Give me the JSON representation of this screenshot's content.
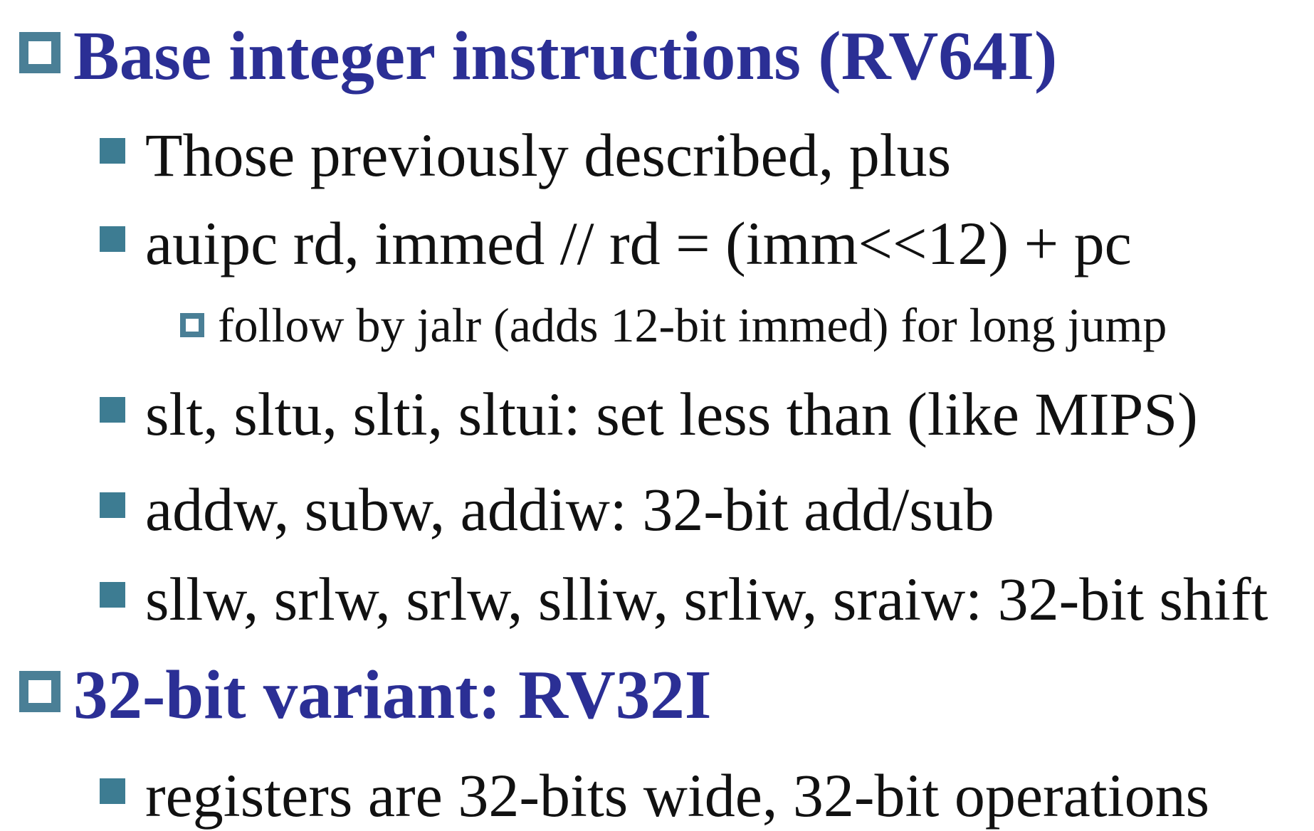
{
  "items": [
    {
      "level": 1,
      "text": "Base integer instructions (RV64I)",
      "bullet_icon": "hollow-square-icon"
    },
    {
      "level": 2,
      "text": "Those previously described, plus",
      "bullet_icon": "solid-square-icon"
    },
    {
      "level": 2,
      "text": "auipc rd, immed  // rd = (imm<<12) + pc",
      "bullet_icon": "solid-square-icon"
    },
    {
      "level": 3,
      "text": "follow by jalr (adds 12-bit immed) for long jump",
      "bullet_icon": "hollow-square-icon"
    },
    {
      "level": 2,
      "text": "slt, sltu, slti, sltui: set less than (like MIPS)",
      "bullet_icon": "solid-square-icon"
    },
    {
      "level": 2,
      "text": "addw, subw, addiw: 32-bit add/sub",
      "bullet_icon": "solid-square-icon"
    },
    {
      "level": 2,
      "text": "sllw, srlw, srlw, slliw, srliw, sraiw: 32-bit shift",
      "bullet_icon": "solid-square-icon"
    },
    {
      "level": 1,
      "text": "32-bit variant: RV32I",
      "bullet_icon": "hollow-square-icon"
    },
    {
      "level": 2,
      "text": "registers are 32-bits wide, 32-bit operations",
      "bullet_icon": "solid-square-icon"
    }
  ],
  "colors": {
    "heading": "#2b2f95",
    "body_text": "#111111",
    "bullet": "#3d7c92",
    "background": "#ffffff"
  }
}
